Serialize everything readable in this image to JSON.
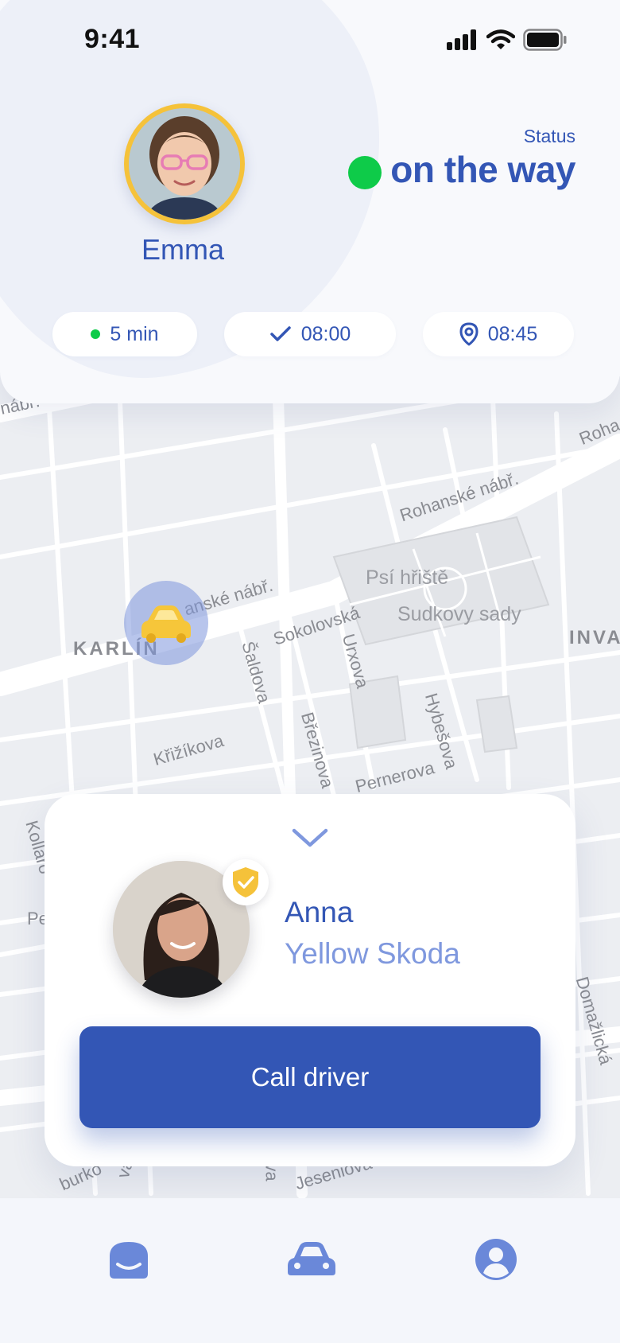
{
  "status_bar": {
    "time": "9:41",
    "icons": [
      "signal-icon",
      "wifi-icon",
      "battery-icon"
    ]
  },
  "child": {
    "name": "Emma"
  },
  "status": {
    "label": "Status",
    "value": "on the way",
    "dot_color": "#0ecb49"
  },
  "chips": [
    {
      "icon": "green-dot",
      "text": "5 min"
    },
    {
      "icon": "checkmark-icon",
      "text": "08:00"
    },
    {
      "icon": "location-pin-icon",
      "text": "08:45"
    }
  ],
  "map": {
    "labels": {
      "street_1": "nábř.",
      "street_2": "Rohanské nábř.",
      "street_3": "Roha",
      "street_4": "anské nábř.",
      "place_1": "Psí hřiště",
      "place_2": "Sudkovy sady",
      "district_1": "KARLÍN",
      "district_2": "INVA",
      "street_5": "Sokolovská",
      "street_6": "Šaldova",
      "street_7": "Urxova",
      "street_8": "Březinova",
      "street_9": "Hybešova",
      "street_10": "Křižíkova",
      "street_11": "Pernerova",
      "street_12": "Kollaro",
      "street_13": "Pe",
      "street_14": "Jeseniova",
      "street_15": "Domažlická",
      "street_16": "burko",
      "street_17": "va",
      "street_18": "va"
    }
  },
  "driver": {
    "name": "Anna",
    "car": "Yellow Skoda",
    "call_label": "Call driver"
  },
  "colors": {
    "accent": "#3356b5",
    "accent_light": "#7f98de",
    "success": "#0ecb49",
    "badge": "#f5c23a"
  },
  "tabs": [
    {
      "icon": "home-face-icon"
    },
    {
      "icon": "car-icon"
    },
    {
      "icon": "profile-icon"
    }
  ]
}
